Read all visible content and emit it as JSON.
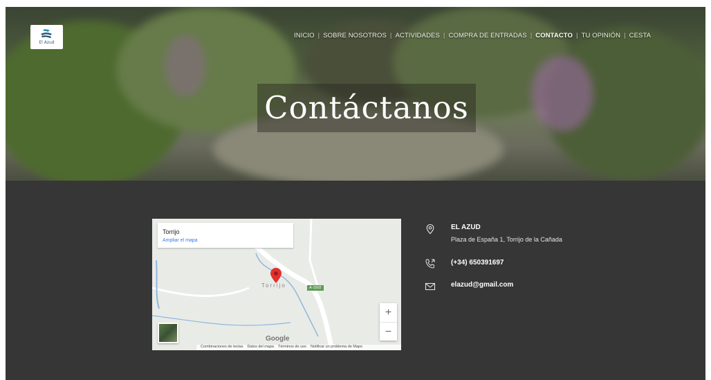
{
  "logo": {
    "text": "El Azud"
  },
  "nav": {
    "items": [
      "INICIO",
      "SOBRE NOSOTROS",
      "ACTIVIDADES",
      "COMPRA DE ENTRADAS",
      "CONTACTO",
      "TU OPINIÓN",
      "CESTA"
    ],
    "active": "CONTACTO"
  },
  "hero": {
    "title": "Contáctanos"
  },
  "map": {
    "place": "Torrijo",
    "enlarge_link": "Ampliar el mapa",
    "town_label": "Torrijo",
    "road_shield": "A-1502",
    "google": "Google",
    "zoom_in": "+",
    "zoom_out": "−",
    "footer": [
      "Combinaciones de teclas",
      "Datos del mapa",
      "Términos de uso",
      "Notificar un problema de Maps"
    ]
  },
  "contact": {
    "name": "EL AZUD",
    "address": "Plaza de España 1, Torrijo de la Cañada",
    "phone": "(+34) 650391697",
    "email": "elazud@gmail.com"
  },
  "colors": {
    "content_bg": "#363636",
    "accent_link": "#3b78e7",
    "pin": "#e0312d"
  }
}
